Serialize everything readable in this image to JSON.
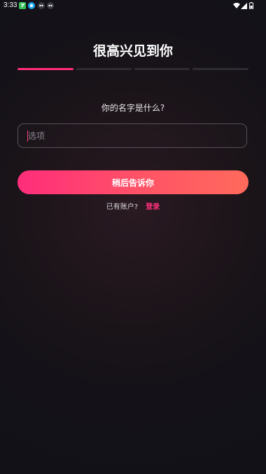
{
  "status_bar": {
    "time": "3:33",
    "icons": [
      "app-green-icon",
      "app-blue-icon",
      "app-mask-icon",
      "app-mask-icon",
      "wifi-icon",
      "signal-icon",
      "battery-icon"
    ]
  },
  "header": {
    "title": "很高兴见到你"
  },
  "progress": {
    "steps_total": 4,
    "current_step": 1,
    "active_color": "#ff2d78",
    "inactive_color": "#2f2d34"
  },
  "form": {
    "question": "你的名字是什么?",
    "name_placeholder": "选项",
    "name_value": ""
  },
  "actions": {
    "later_label": "稍后告诉你",
    "have_account_label": "已有账户?",
    "login_label": "登录"
  },
  "colors": {
    "accent": "#ff2d7b",
    "accent_end": "#ff6a5c",
    "background": "#141218"
  }
}
